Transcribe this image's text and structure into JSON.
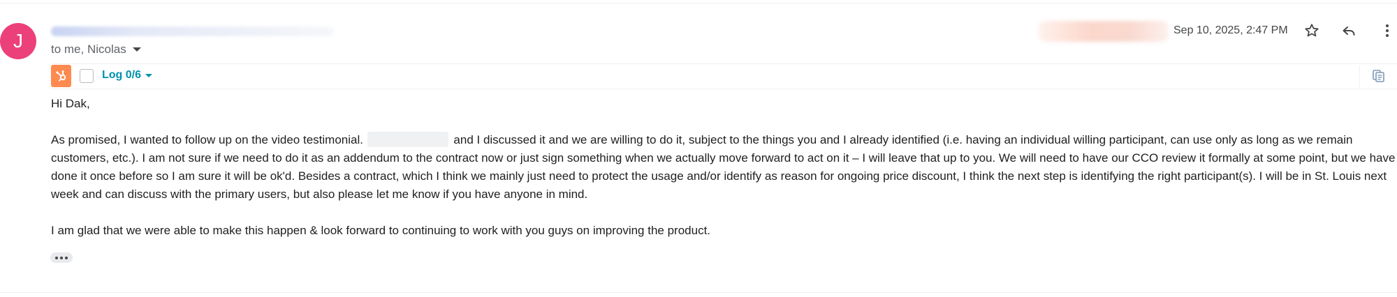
{
  "message": {
    "avatar_initial": "J",
    "recipients_label": "to me, Nicolas",
    "date": "Sep 10, 2025, 2:47 PM",
    "greeting": "Hi Dak,",
    "paragraph1_part1": "As promised, I wanted to follow up on the video testimonial. ",
    "paragraph1_part2": " and I discussed it and we are willing to do it, subject to the things you and I already identified (i.e. having an individual willing participant, can use only as long as we remain customers, etc.). I am not sure if we need to do it as an addendum to the contract now or just sign something when we actually move forward to act on it – I will leave that up to you. We will need to have our CCO review it formally at some point, but we have done it once before so I am sure it will be ok'd. Besides a contract, which I think we mainly just need to protect the usage and/or identify as reason for ongoing price discount, I think the next step is identifying the right participant(s). I will be in St. Louis next week and can discuss with the primary users, but also please let me know if you have anyone in mind.",
    "paragraph2": "I am glad that we were able to make this happen & look forward to continuing to work with you guys on improving the product."
  },
  "hubspot": {
    "log_label": "Log 0/6"
  },
  "colors": {
    "avatar": "#ec407a",
    "hubspot_orange": "#ff8a50",
    "hubspot_link": "#0091ae"
  },
  "icons": {
    "star": "star-icon",
    "reply": "reply-icon",
    "more": "more-vert-icon",
    "hubspot": "hubspot-sprocket-icon",
    "copy": "copy-icon",
    "ellipsis": "show-trimmed-content-icon"
  }
}
